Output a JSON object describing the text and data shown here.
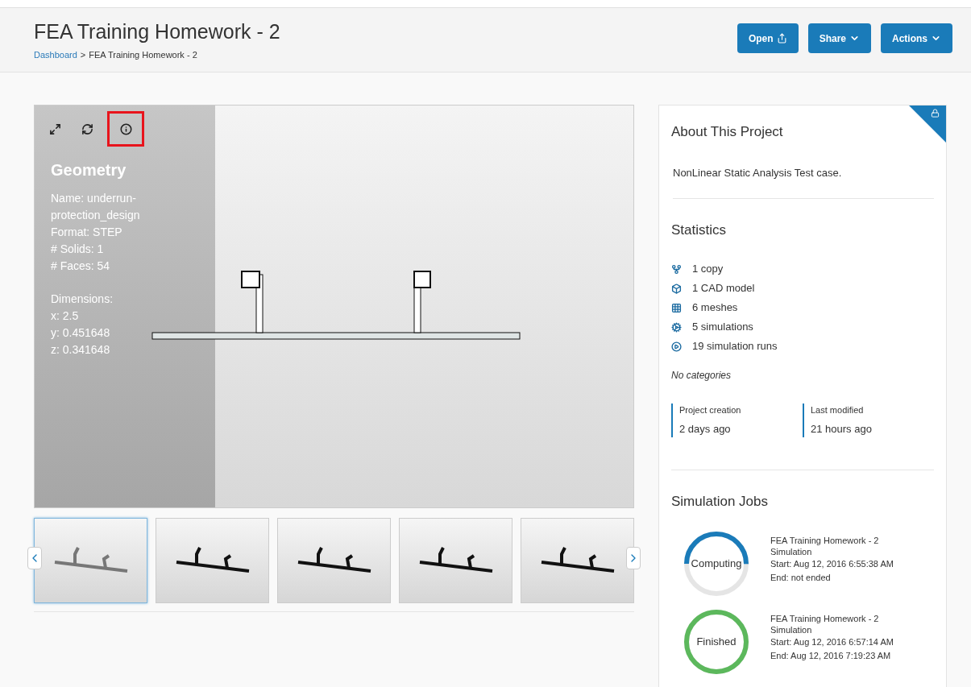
{
  "header": {
    "title": "FEA Training Homework - 2",
    "breadcrumb": [
      {
        "label": "Dashboard",
        "kind": "link"
      },
      {
        "label": ">",
        "kind": "separator"
      },
      {
        "label": "FEA Training Homework - 2",
        "kind": "current"
      }
    ],
    "buttons": [
      {
        "label": "Open",
        "kind": "share"
      },
      {
        "label": "Share",
        "kind": "dropdown"
      },
      {
        "label": "Actions",
        "kind": "dropdown"
      }
    ]
  },
  "viewer": {
    "tools": [
      {
        "kind": "fullscreen",
        "highlighted": false
      },
      {
        "kind": "refresh",
        "highlighted": false
      },
      {
        "kind": "info",
        "highlighted": true
      }
    ],
    "info": {
      "title": "Geometry",
      "groups": [
        [
          "Name: underrun-protection_design",
          "Format: STEP",
          "# Solids: 1",
          "# Faces: 54"
        ],
        [
          "Dimensions:",
          "x: 2.5",
          "y: 0.451648",
          "z: 0.341648"
        ]
      ]
    },
    "thumbnails": [
      {
        "selected": true
      },
      {
        "selected": false
      },
      {
        "selected": false
      },
      {
        "selected": false
      },
      {
        "selected": false
      }
    ]
  },
  "about": {
    "title": "About This Project",
    "description": "NonLinear Static Analysis Test case.",
    "locked": true
  },
  "statistics": {
    "title": "Statistics",
    "items": [
      {
        "kind": "fork",
        "text": "1 copy"
      },
      {
        "kind": "cube",
        "text": "1 CAD model"
      },
      {
        "kind": "grid",
        "text": "6 meshes"
      },
      {
        "kind": "gears",
        "text": "5 simulations"
      },
      {
        "kind": "play",
        "text": "19 simulation runs"
      }
    ],
    "categories": "No categories",
    "dates": [
      {
        "label": "Project creation",
        "value": "2 days ago"
      },
      {
        "label": "Last modified",
        "value": "21 hours ago"
      }
    ]
  },
  "jobs": {
    "title": "Simulation Jobs",
    "items": [
      {
        "status": "Computing",
        "kind": "computing",
        "level": 0.5,
        "name": "FEA Training Homework - 2 Simulation",
        "start": "Start: Aug 12, 2016 6:55:38 AM",
        "end": "End: not ended"
      },
      {
        "status": "Finished",
        "kind": "finished",
        "level": 1,
        "name": "FEA Training Homework - 2 Simulation",
        "start": "Start: Aug 12, 2016 6:57:14 AM",
        "end": "End: Aug 12, 2016 7:19:23 AM"
      }
    ]
  }
}
